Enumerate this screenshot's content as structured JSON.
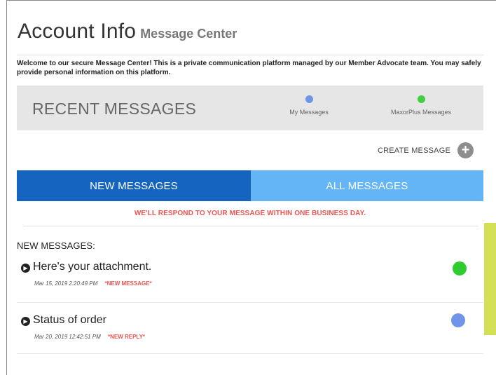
{
  "header": {
    "title": "Account Info",
    "subtitle": "Message Center"
  },
  "welcome_text": "Welcome to our secure Message Center! This is a private communication platform managed by our Member Advocate team. You may safely provide personal information on this platform.",
  "recent": {
    "title": "RECENT MESSAGES",
    "legend": [
      {
        "label": "My Messages",
        "color": "#6f94ea"
      },
      {
        "label": "MaxorPlus Messages",
        "color": "#3fd13f"
      }
    ]
  },
  "create_message_label": "CREATE MESSAGE",
  "plus_glyph": "+",
  "tabs": [
    {
      "label": "NEW MESSAGES",
      "active": true,
      "color": "#1565c0"
    },
    {
      "label": "ALL MESSAGES",
      "active": false,
      "color": "#64b5f6"
    }
  ],
  "notice": "WE'LL RESPOND TO YOUR MESSAGE WITHIN ONE BUSINESS DAY.",
  "new_messages_heading": "NEW MESSAGES:",
  "messages": [
    {
      "subject": "Here's your attachment.",
      "date": "Mar 15, 2019 2:20:49 PM",
      "badge": "*NEW MESSAGE*",
      "dot_color": "#2ecc2e",
      "icon": "chevron-right-icon"
    },
    {
      "subject": "Status of order",
      "date": "Mar 20, 2019 12:42:51 PM",
      "badge": "*NEW REPLY*",
      "dot_color": "#6f94ea",
      "icon": "chevron-right-icon"
    }
  ],
  "colors": {
    "accent_dark_blue": "#1565c0",
    "accent_light_blue": "#64b5f6",
    "alert_red": "#ef5350",
    "side_tab": "#d4e157"
  }
}
